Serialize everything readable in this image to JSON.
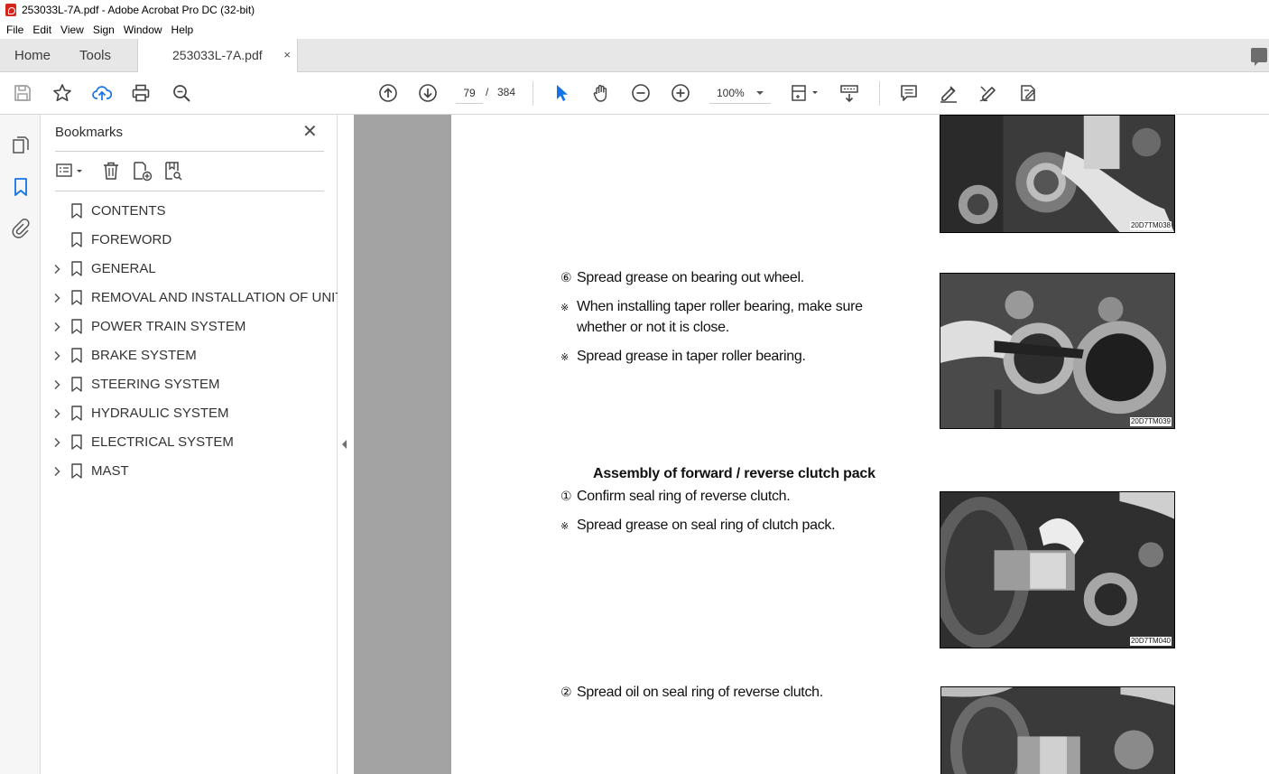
{
  "window": {
    "title": "253033L-7A.pdf - Adobe Acrobat Pro DC (32-bit)"
  },
  "menu": [
    "File",
    "Edit",
    "View",
    "Sign",
    "Window",
    "Help"
  ],
  "tabs": {
    "home": "Home",
    "tools": "Tools",
    "document": "253033L-7A.pdf",
    "close": "×"
  },
  "toolbar": {
    "page_current": "79",
    "page_separator": "/",
    "page_total": "384",
    "zoom": "100%"
  },
  "bookmarks": {
    "title": "Bookmarks",
    "close": "✕",
    "items": [
      {
        "label": "CONTENTS",
        "expandable": false
      },
      {
        "label": "FOREWORD",
        "expandable": false
      },
      {
        "label": "GENERAL",
        "expandable": true
      },
      {
        "label": "REMOVAL AND INSTALLATION OF UNIT",
        "expandable": true
      },
      {
        "label": "POWER TRAIN SYSTEM",
        "expandable": true
      },
      {
        "label": "BRAKE SYSTEM",
        "expandable": true
      },
      {
        "label": "STEERING SYSTEM",
        "expandable": true
      },
      {
        "label": "HYDRAULIC SYSTEM",
        "expandable": true
      },
      {
        "label": "ELECTRICAL SYSTEM",
        "expandable": true
      },
      {
        "label": "MAST",
        "expandable": true
      }
    ]
  },
  "document": {
    "step6": {
      "mark": "⑥",
      "text": "Spread grease on bearing out wheel."
    },
    "note1": {
      "mark": "※",
      "line1": "When installing taper roller bearing, make sure",
      "line2": "whether or not it is close."
    },
    "note2": {
      "mark": "※",
      "text": "Spread grease in taper roller bearing."
    },
    "section_heading": "Assembly of forward / reverse clutch pack",
    "step1": {
      "mark": "①",
      "text": "Confirm seal ring of reverse clutch."
    },
    "note3": {
      "mark": "※",
      "text": "Spread grease on seal ring of clutch pack."
    },
    "step2": {
      "mark": "②",
      "text": "Spread oil on seal ring of reverse clutch."
    },
    "figures": [
      "20D7TM038",
      "20D7TM039",
      "20D7TM040"
    ]
  }
}
